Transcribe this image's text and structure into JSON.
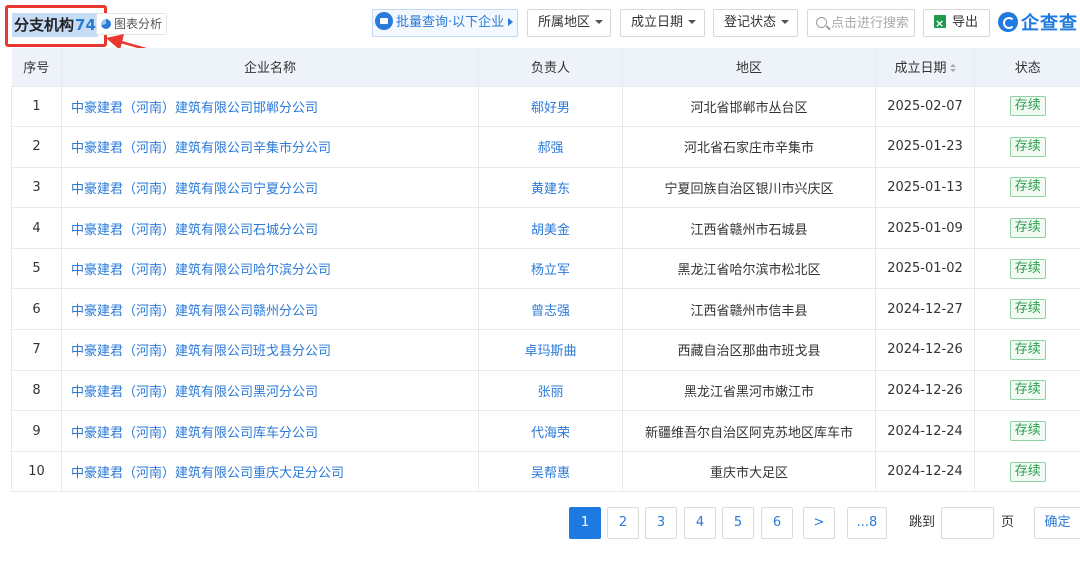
{
  "header": {
    "title": "分支机构",
    "count": "74",
    "chart_analysis_label": "图表分析",
    "batch_query_label": "批量查询·以下企业",
    "filters": {
      "region": "所属地区",
      "founded_date": "成立日期",
      "registration_status": "登记状态"
    },
    "search_placeholder": "点击进行搜索",
    "export_label": "导出",
    "brand_name": "企查查",
    "colors": {
      "accent": "#1e7ae0",
      "highlight_box": "#e8382f",
      "status_green": "#2e9e4f"
    }
  },
  "table": {
    "columns": [
      "序号",
      "企业名称",
      "负责人",
      "地区",
      "成立日期",
      "状态"
    ],
    "rows": [
      {
        "no": "1",
        "name": "中豪建君（河南）建筑有限公司邯郸分公司",
        "person": "郗好男",
        "region": "河北省邯郸市丛台区",
        "date": "2025-02-07",
        "status": "存续"
      },
      {
        "no": "2",
        "name": "中豪建君（河南）建筑有限公司辛集市分公司",
        "person": "郝强",
        "region": "河北省石家庄市辛集市",
        "date": "2025-01-23",
        "status": "存续"
      },
      {
        "no": "3",
        "name": "中豪建君（河南）建筑有限公司宁夏分公司",
        "person": "黄建东",
        "region": "宁夏回族自治区银川市兴庆区",
        "date": "2025-01-13",
        "status": "存续"
      },
      {
        "no": "4",
        "name": "中豪建君（河南）建筑有限公司石城分公司",
        "person": "胡美金",
        "region": "江西省赣州市石城县",
        "date": "2025-01-09",
        "status": "存续"
      },
      {
        "no": "5",
        "name": "中豪建君（河南）建筑有限公司哈尔滨分公司",
        "person": "杨立军",
        "region": "黑龙江省哈尔滨市松北区",
        "date": "2025-01-02",
        "status": "存续"
      },
      {
        "no": "6",
        "name": "中豪建君（河南）建筑有限公司赣州分公司",
        "person": "曾志强",
        "region": "江西省赣州市信丰县",
        "date": "2024-12-27",
        "status": "存续"
      },
      {
        "no": "7",
        "name": "中豪建君（河南）建筑有限公司班戈县分公司",
        "person": "卓玛斯曲",
        "region": "西藏自治区那曲市班戈县",
        "date": "2024-12-26",
        "status": "存续"
      },
      {
        "no": "8",
        "name": "中豪建君（河南）建筑有限公司黑河分公司",
        "person": "张丽",
        "region": "黑龙江省黑河市嫩江市",
        "date": "2024-12-26",
        "status": "存续"
      },
      {
        "no": "9",
        "name": "中豪建君（河南）建筑有限公司库车分公司",
        "person": "代海荣",
        "region": "新疆维吾尔自治区阿克苏地区库车市",
        "date": "2024-12-24",
        "status": "存续"
      },
      {
        "no": "10",
        "name": "中豪建君（河南）建筑有限公司重庆大足分公司",
        "person": "吴帮惠",
        "region": "重庆市大足区",
        "date": "2024-12-24",
        "status": "存续"
      }
    ]
  },
  "pagination": {
    "pages": [
      "1",
      "2",
      "3",
      "4",
      "5",
      "6"
    ],
    "current": "1",
    "next": ">",
    "last": "...8",
    "jump_label": "跳到",
    "page_unit": "页",
    "confirm_label": "确定"
  }
}
